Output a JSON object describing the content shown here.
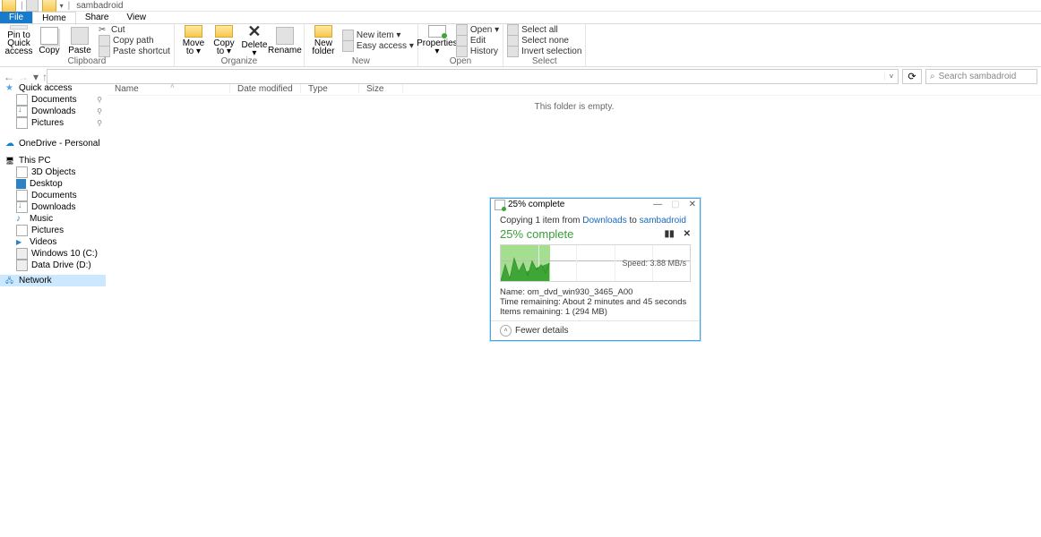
{
  "title": {
    "app_folder": "sambadroid"
  },
  "tabs": {
    "file": "File",
    "home": "Home",
    "share": "Share",
    "view": "View"
  },
  "ribbon": {
    "clipboard": {
      "pin": "Pin to Quick\naccess",
      "copy": "Copy",
      "paste": "Paste",
      "cut": "Cut",
      "copy_path": "Copy path",
      "paste_shortcut": "Paste shortcut",
      "label": "Clipboard"
    },
    "organize": {
      "move_to": "Move\nto ▾",
      "copy_to": "Copy\nto ▾",
      "delete": "Delete\n▾",
      "rename": "Rename",
      "label": "Organize"
    },
    "new": {
      "new_folder": "New\nfolder",
      "new_item": "New item ▾",
      "easy_access": "Easy access ▾",
      "label": "New"
    },
    "open": {
      "properties": "Properties\n▾",
      "open": "Open ▾",
      "edit": "Edit",
      "history": "History",
      "label": "Open"
    },
    "select": {
      "select_all": "Select all",
      "select_none": "Select none",
      "invert": "Invert selection",
      "label": "Select"
    }
  },
  "search": {
    "placeholder": "Search sambadroid"
  },
  "columns": {
    "name": "Name",
    "date": "Date modified",
    "type": "Type",
    "size": "Size"
  },
  "tree": {
    "quick_access": "Quick access",
    "documents": "Documents",
    "downloads": "Downloads",
    "pictures": "Pictures",
    "onedrive": "OneDrive - Personal",
    "this_pc": "This PC",
    "objects3d": "3D Objects",
    "desktop": "Desktop",
    "documents2": "Documents",
    "downloads2": "Downloads",
    "music": "Music",
    "pictures2": "Pictures",
    "videos": "Videos",
    "c_drive": "Windows 10 (C:)",
    "d_drive": "Data Drive (D:)",
    "network": "Network"
  },
  "main": {
    "empty": "This folder is empty."
  },
  "dialog": {
    "title": "25% complete",
    "line_prefix": "Copying 1 item from ",
    "line_src": "Downloads",
    "line_mid": " to ",
    "line_dst": "sambadroid",
    "percent": "25% complete",
    "speed": "Speed: 3.88 MB/s",
    "name_lbl": "Name:  ",
    "name_val": "om_dvd_win930_3465_A00",
    "time_lbl": "Time remaining:  ",
    "time_val": "About 2 minutes and 45 seconds",
    "items_lbl": "Items remaining:  ",
    "items_val": "1 (294 MB)",
    "fewer": "Fewer details"
  }
}
